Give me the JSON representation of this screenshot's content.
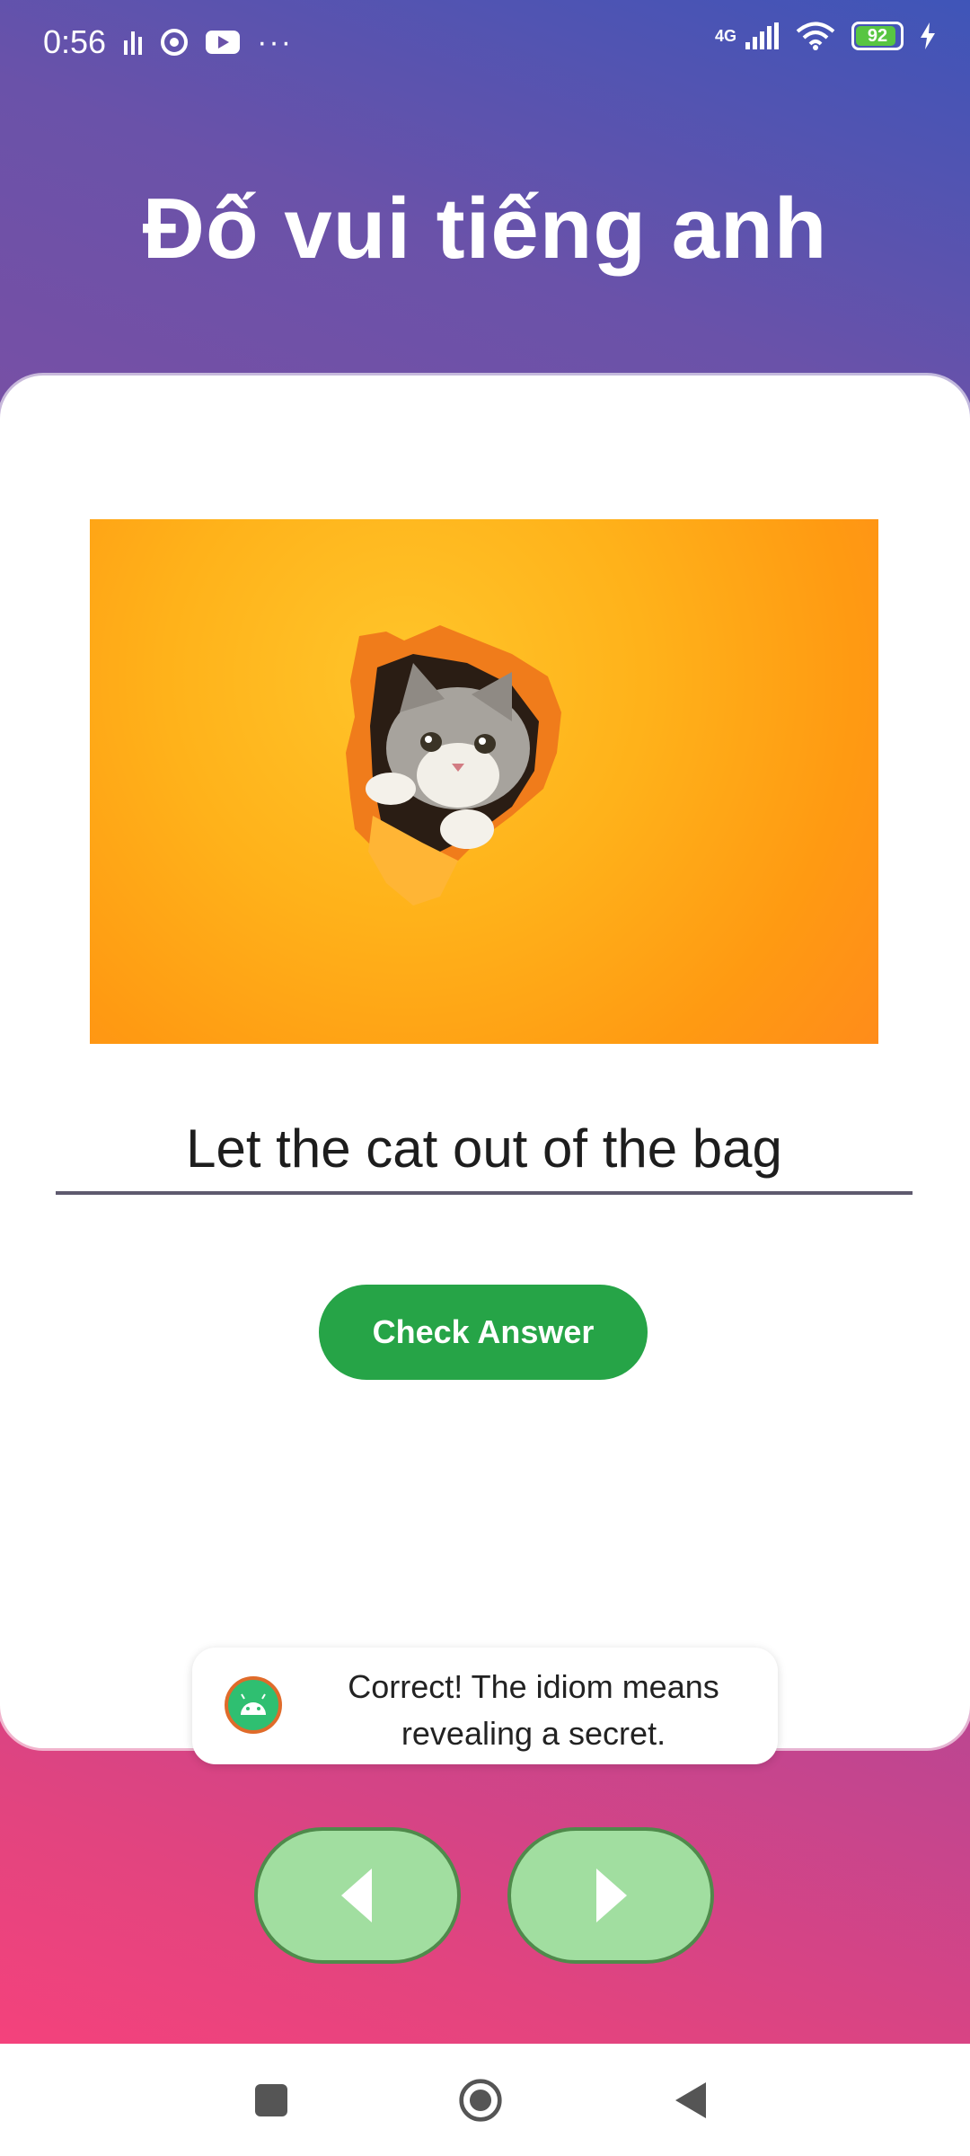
{
  "status_bar": {
    "time": "0:56",
    "network": "4G",
    "battery": "92",
    "more": "···"
  },
  "page": {
    "title": "Đố vui tiếng anh"
  },
  "quiz": {
    "image_icon": "cat-peeking-through-orange-paper",
    "answer_value": "Let the cat out of the bag",
    "check_label": "Check Answer"
  },
  "toast": {
    "line1": "Correct! The idiom means",
    "line2": "revealing a secret."
  },
  "navigation": {
    "prev_icon": "triangle-left-icon",
    "next_icon": "triangle-right-icon"
  },
  "colors": {
    "gradient_top": "#3f55b8",
    "gradient_bottom": "#f4427c",
    "check_button": "#26a447",
    "nav_button_fill": "#a1dea0",
    "nav_button_border": "#4f8a4b"
  }
}
